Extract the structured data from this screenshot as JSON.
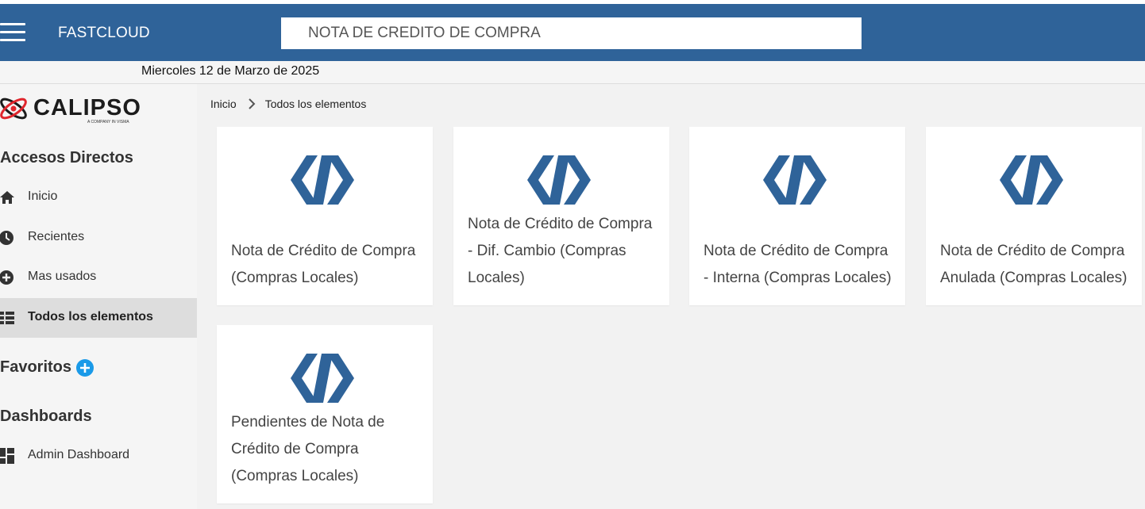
{
  "topbar": {
    "app_title": "FASTCLOUD",
    "search_value": "NOTA DE CREDITO DE COMPRA",
    "bg_color": "#2f6399"
  },
  "datebar": {
    "date": "Miercoles 12 de Marzo de 2025"
  },
  "sidebar": {
    "logo": {
      "name": "CALIPSO",
      "tagline": "A COMPANY IN VISMA"
    },
    "shortcuts_title": "Accesos Directos",
    "items": [
      {
        "label": "Inicio",
        "icon": "home-icon"
      },
      {
        "label": "Recientes",
        "icon": "clock-icon"
      },
      {
        "label": "Mas usados",
        "icon": "plus-circle-icon"
      },
      {
        "label": "Todos los elementos",
        "icon": "grid-icon",
        "active": true
      }
    ],
    "favorites_title": "Favoritos",
    "dashboards_title": "Dashboards",
    "dashboards": [
      {
        "label": "Admin Dashboard",
        "icon": "dashboard-icon"
      }
    ]
  },
  "breadcrumb": {
    "home": "Inicio",
    "current": "Todos los elementos"
  },
  "cards": [
    {
      "label": "Nota de Crédito de Compra (Compras Locales)",
      "icon": "code-brackets-icon"
    },
    {
      "label": "Nota de Crédito de Compra - Dif. Cambio (Compras Locales)",
      "icon": "code-brackets-icon"
    },
    {
      "label": "Nota de Crédito de Compra - Interna (Compras Locales)",
      "icon": "code-brackets-icon"
    },
    {
      "label": "Nota de Crédito de Compra Anulada (Compras Locales)",
      "icon": "code-brackets-icon"
    },
    {
      "label": "Pendientes de Nota de Crédito de Compra (Compras Locales)",
      "icon": "code-brackets-icon"
    }
  ],
  "colors": {
    "brand": "#2f6399",
    "accent": "#1a9ae8",
    "logo_red": "#e0262d"
  }
}
